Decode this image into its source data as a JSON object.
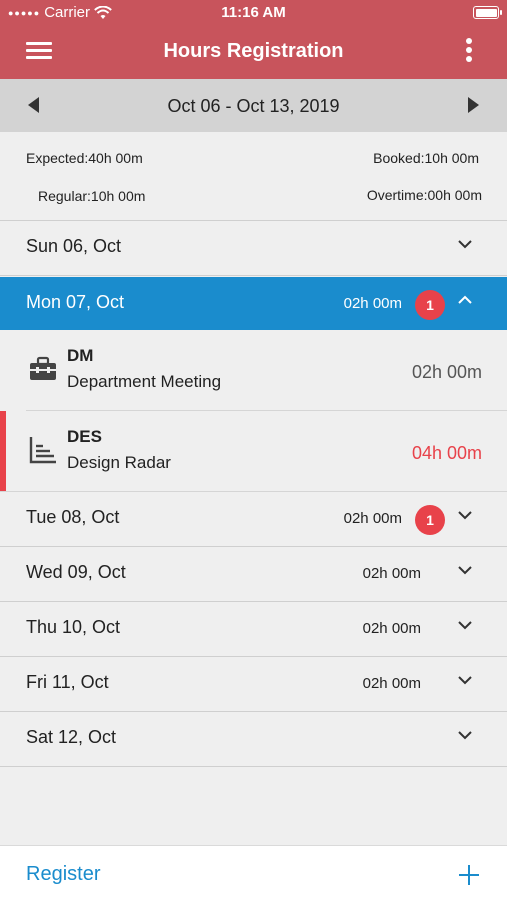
{
  "status_bar": {
    "carrier": "Carrier",
    "time": "11:16 AM"
  },
  "header": {
    "title": "Hours Registration"
  },
  "week": {
    "range": "Oct 06 - Oct 13, 2019"
  },
  "summary": {
    "expected": "Expected:40h 00m",
    "booked": "Booked:10h 00m",
    "regular": "Regular:10h 00m",
    "overtime": "Overtime:00h 00m"
  },
  "days": [
    {
      "label": "Sun 06, Oct",
      "hours": "",
      "badge": ""
    },
    {
      "label": "Mon 07, Oct",
      "hours": "02h 00m",
      "badge": "1"
    },
    {
      "label": "Tue 08, Oct",
      "hours": "02h 00m",
      "badge": "1"
    },
    {
      "label": "Wed 09, Oct",
      "hours": "02h 00m",
      "badge": ""
    },
    {
      "label": "Thu 10, Oct",
      "hours": "02h 00m",
      "badge": ""
    },
    {
      "label": "Fri 11, Oct",
      "hours": "02h 00m",
      "badge": ""
    },
    {
      "label": "Sat 12, Oct",
      "hours": "",
      "badge": ""
    }
  ],
  "entries": [
    {
      "code": "DM",
      "description": "Department Meeting",
      "hours": "02h 00m",
      "icon": "briefcase-icon"
    },
    {
      "code": "DES",
      "description": "Design Radar",
      "hours": "04h 00m",
      "icon": "chart-icon"
    }
  ],
  "footer": {
    "register_label": "Register"
  },
  "colors": {
    "header": "#c8545c",
    "active": "#1a8ccd",
    "badge": "#e8424a",
    "warning": "#e8424a"
  }
}
